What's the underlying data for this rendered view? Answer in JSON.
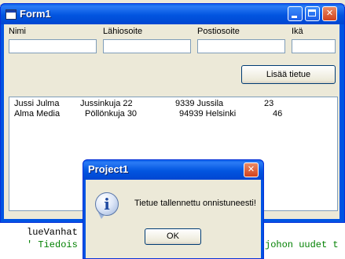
{
  "form": {
    "title": "Form1",
    "labels": {
      "name": "Nimi",
      "street": "Lähiosoite",
      "postal": "Postiosoite",
      "age": "Ikä"
    },
    "inputs": {
      "name": "",
      "street": "",
      "postal": "",
      "age": ""
    },
    "add_button": "Lisää tietue",
    "list_rows": [
      {
        "name": "Jussi Julma",
        "street": "Jussinkuja 22",
        "zip_city": "9339 Jussila",
        "age": "23"
      },
      {
        "name": "Alma Media",
        "street": "Pöllönkuja 30",
        "zip_city": "94939 Helsinki",
        "age": "46"
      }
    ],
    "caption_buttons": {
      "minimize": "_",
      "maximize": "□",
      "close": "✕"
    }
  },
  "code": {
    "line1": "lueVanhat",
    "line2": "' Tiedois",
    "line2_right": "johon uudet t"
  },
  "dialog": {
    "title": "Project1",
    "message": "Tietue tallennettu onnistuneesti!",
    "ok_button": "OK",
    "close": "✕",
    "icon": "info-icon"
  },
  "colors": {
    "xp_title_blue": "#0054e3",
    "window_face": "#ece9d8",
    "close_red": "#d2421d"
  }
}
